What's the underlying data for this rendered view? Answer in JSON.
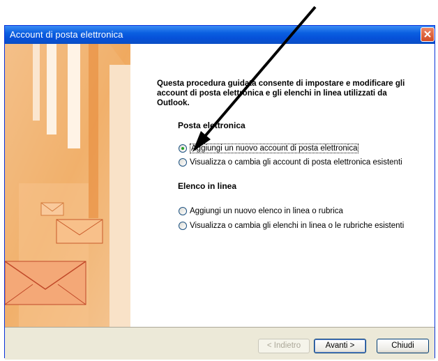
{
  "window": {
    "title": "Account di posta elettronica"
  },
  "intro": "Questa procedura guidata consente di impostare e modificare gli account di posta elettronica e gli elenchi in linea utilizzati da Outlook.",
  "sections": [
    {
      "title": "Posta elettronica",
      "options": [
        {
          "label": "Aggiungi un nuovo account di posta elettronica",
          "checked": true
        },
        {
          "label": "Visualizza o cambia gli account di posta elettronica esistenti",
          "checked": false
        }
      ]
    },
    {
      "title": "Elenco in linea",
      "options": [
        {
          "label": "Aggiungi un nuovo elenco in linea o rubrica",
          "checked": false
        },
        {
          "label": "Visualizza o cambia gli elenchi in linea o le rubriche esistenti",
          "checked": false
        }
      ]
    }
  ],
  "buttons": {
    "back": "< Indietro",
    "next": "Avanti >",
    "close": "Chiudi"
  },
  "colors": {
    "titlebar": "#0a5fe0",
    "accent": "#21a121",
    "dialog_bg": "#ece9d8"
  },
  "icons": {
    "close": "close-x-icon",
    "annotation": "arrow-annotation-icon"
  }
}
